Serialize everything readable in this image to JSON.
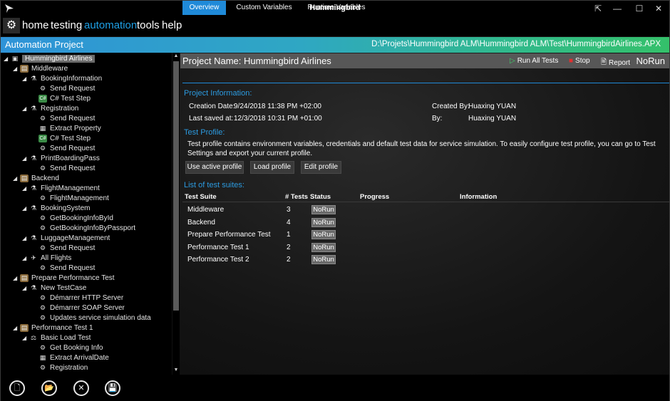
{
  "window": {
    "title": "Hummingbird",
    "controls": [
      "restore-icon",
      "minimize-icon",
      "maximize-icon",
      "close-icon"
    ]
  },
  "menu": {
    "items": [
      "home",
      "testing",
      "automation",
      "tools",
      "help"
    ],
    "active": "automation"
  },
  "project_bar": {
    "title": "Automation Project",
    "path": "D:\\Projets\\Hummingbird ALM\\Hummingbird ALM\\Test\\HummingbirdAirlines.APX"
  },
  "tree": [
    {
      "label": "Hummingbird Airlines",
      "depth": 0,
      "icon": "project-icon"
    },
    {
      "label": "Middleware",
      "depth": 1,
      "icon": "suite-icon"
    },
    {
      "label": "BookingInformation",
      "depth": 2,
      "icon": "testcase-icon"
    },
    {
      "label": "Send Request",
      "depth": 3,
      "icon": "step-icon"
    },
    {
      "label": "C# Test Step",
      "depth": 3,
      "icon": "csharp-icon"
    },
    {
      "label": "Registration",
      "depth": 2,
      "icon": "testcase-icon"
    },
    {
      "label": "Send Request",
      "depth": 3,
      "icon": "step-icon"
    },
    {
      "label": "Extract Property",
      "depth": 3,
      "icon": "extract-icon"
    },
    {
      "label": "C# Test Step",
      "depth": 3,
      "icon": "csharp-icon"
    },
    {
      "label": "Send Request",
      "depth": 3,
      "icon": "step-icon"
    },
    {
      "label": "PrintBoardingPass",
      "depth": 2,
      "icon": "testcase-icon"
    },
    {
      "label": "Send Request",
      "depth": 3,
      "icon": "step-icon"
    },
    {
      "label": "Backend",
      "depth": 1,
      "icon": "suite-icon"
    },
    {
      "label": "FlightManagement",
      "depth": 2,
      "icon": "testcase-icon"
    },
    {
      "label": "FlightManagement",
      "depth": 3,
      "icon": "step-icon"
    },
    {
      "label": "BookingSystem",
      "depth": 2,
      "icon": "testcase-icon"
    },
    {
      "label": "GetBookingInfoById",
      "depth": 3,
      "icon": "step-icon"
    },
    {
      "label": "GetBookingInfoByPassport",
      "depth": 3,
      "icon": "step-icon"
    },
    {
      "label": "LuggageManagement",
      "depth": 2,
      "icon": "testcase-icon"
    },
    {
      "label": "Send Request",
      "depth": 3,
      "icon": "step-icon"
    },
    {
      "label": "All Flights",
      "depth": 2,
      "icon": "allflights-icon"
    },
    {
      "label": "Send Request",
      "depth": 3,
      "icon": "step-icon"
    },
    {
      "label": "Prepare Performance Test",
      "depth": 1,
      "icon": "suite-icon"
    },
    {
      "label": "New TestCase",
      "depth": 2,
      "icon": "testcase-icon"
    },
    {
      "label": "Démarrer HTTP Server",
      "depth": 3,
      "icon": "step-icon"
    },
    {
      "label": "Démarrer SOAP Server",
      "depth": 3,
      "icon": "step-icon"
    },
    {
      "label": "Updates service simulation data",
      "depth": 3,
      "icon": "step-icon"
    },
    {
      "label": "Performance Test 1",
      "depth": 1,
      "icon": "suite-icon"
    },
    {
      "label": "Basic Load Test",
      "depth": 2,
      "icon": "loadtest-icon"
    },
    {
      "label": "Get Booking Info",
      "depth": 3,
      "icon": "step-icon"
    },
    {
      "label": "Extract ArrivalDate",
      "depth": 3,
      "icon": "extract-icon"
    },
    {
      "label": "Registration",
      "depth": 3,
      "icon": "step-icon"
    }
  ],
  "right": {
    "project_name": "Project Name:  Hummingbird Airlines",
    "run_all": "Run All Tests",
    "stop": "Stop",
    "report": "Report",
    "status": "NoRun",
    "tabs": [
      "Overview",
      "Custom Variables",
      "Runtime Variables"
    ],
    "active_tab": "Overview",
    "info_title": "Project Information:",
    "creation_label": "Creation Date:",
    "creation_value": "9/24/2018 11:38 PM +02:00",
    "saved_label": "Last saved at:",
    "saved_value": "12/3/2018 10:31 PM +01:00",
    "created_by_label": "Created By:",
    "created_by_value": "Huaxing YUAN",
    "by_label": "By:",
    "by_value": "Huaxing YUAN",
    "profile_title": "Test Profile:",
    "profile_desc": "Test profile contains environment variables, credentials and default test data for service simulation. To easily configure test profile, you can go to Test Settings and export your current profile.",
    "btn_use": "Use active profile",
    "btn_load": "Load profile",
    "btn_edit": "Edit profile",
    "suites_title": "List of test suites:",
    "columns": [
      "Test Suite",
      "# Tests",
      "Status",
      "Progress",
      "Information"
    ],
    "suites": [
      {
        "name": "Middleware",
        "tests": "3",
        "status": "NoRun"
      },
      {
        "name": "Backend",
        "tests": "4",
        "status": "NoRun"
      },
      {
        "name": "Prepare Performance Test",
        "tests": "1",
        "status": "NoRun"
      },
      {
        "name": "Performance Test 1",
        "tests": "2",
        "status": "NoRun"
      },
      {
        "name": "Performance Test 2",
        "tests": "2",
        "status": "NoRun"
      }
    ]
  },
  "bottom_buttons": [
    "new-file-icon",
    "open-folder-icon",
    "close-icon",
    "save-icon"
  ]
}
